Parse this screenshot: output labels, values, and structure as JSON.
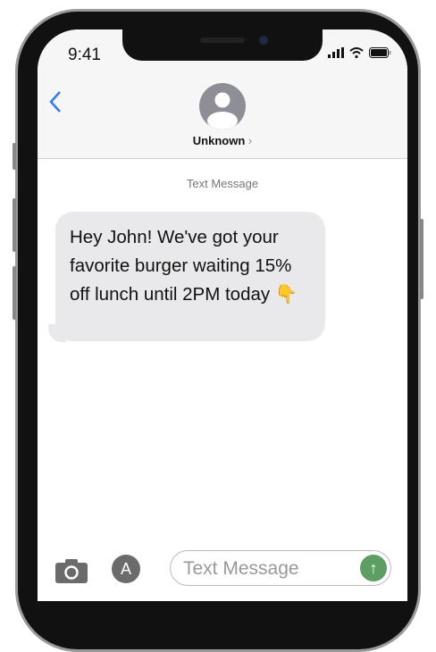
{
  "status_bar": {
    "time": "9:41"
  },
  "header": {
    "contact_name": "Unknown",
    "contact_chevron": "›"
  },
  "thread": {
    "service_label": "Text Message",
    "messages": [
      {
        "text": "Hey John! We've got your favorite burger waiting 15% off lunch until 2PM today",
        "emoji": "👇"
      }
    ]
  },
  "composer": {
    "placeholder": "Text Message",
    "send_icon": "↑",
    "app_icon": "A"
  },
  "colors": {
    "accent": "#2f7bf5",
    "bubble": "#e9e9eb",
    "send": "#5d9f62"
  }
}
